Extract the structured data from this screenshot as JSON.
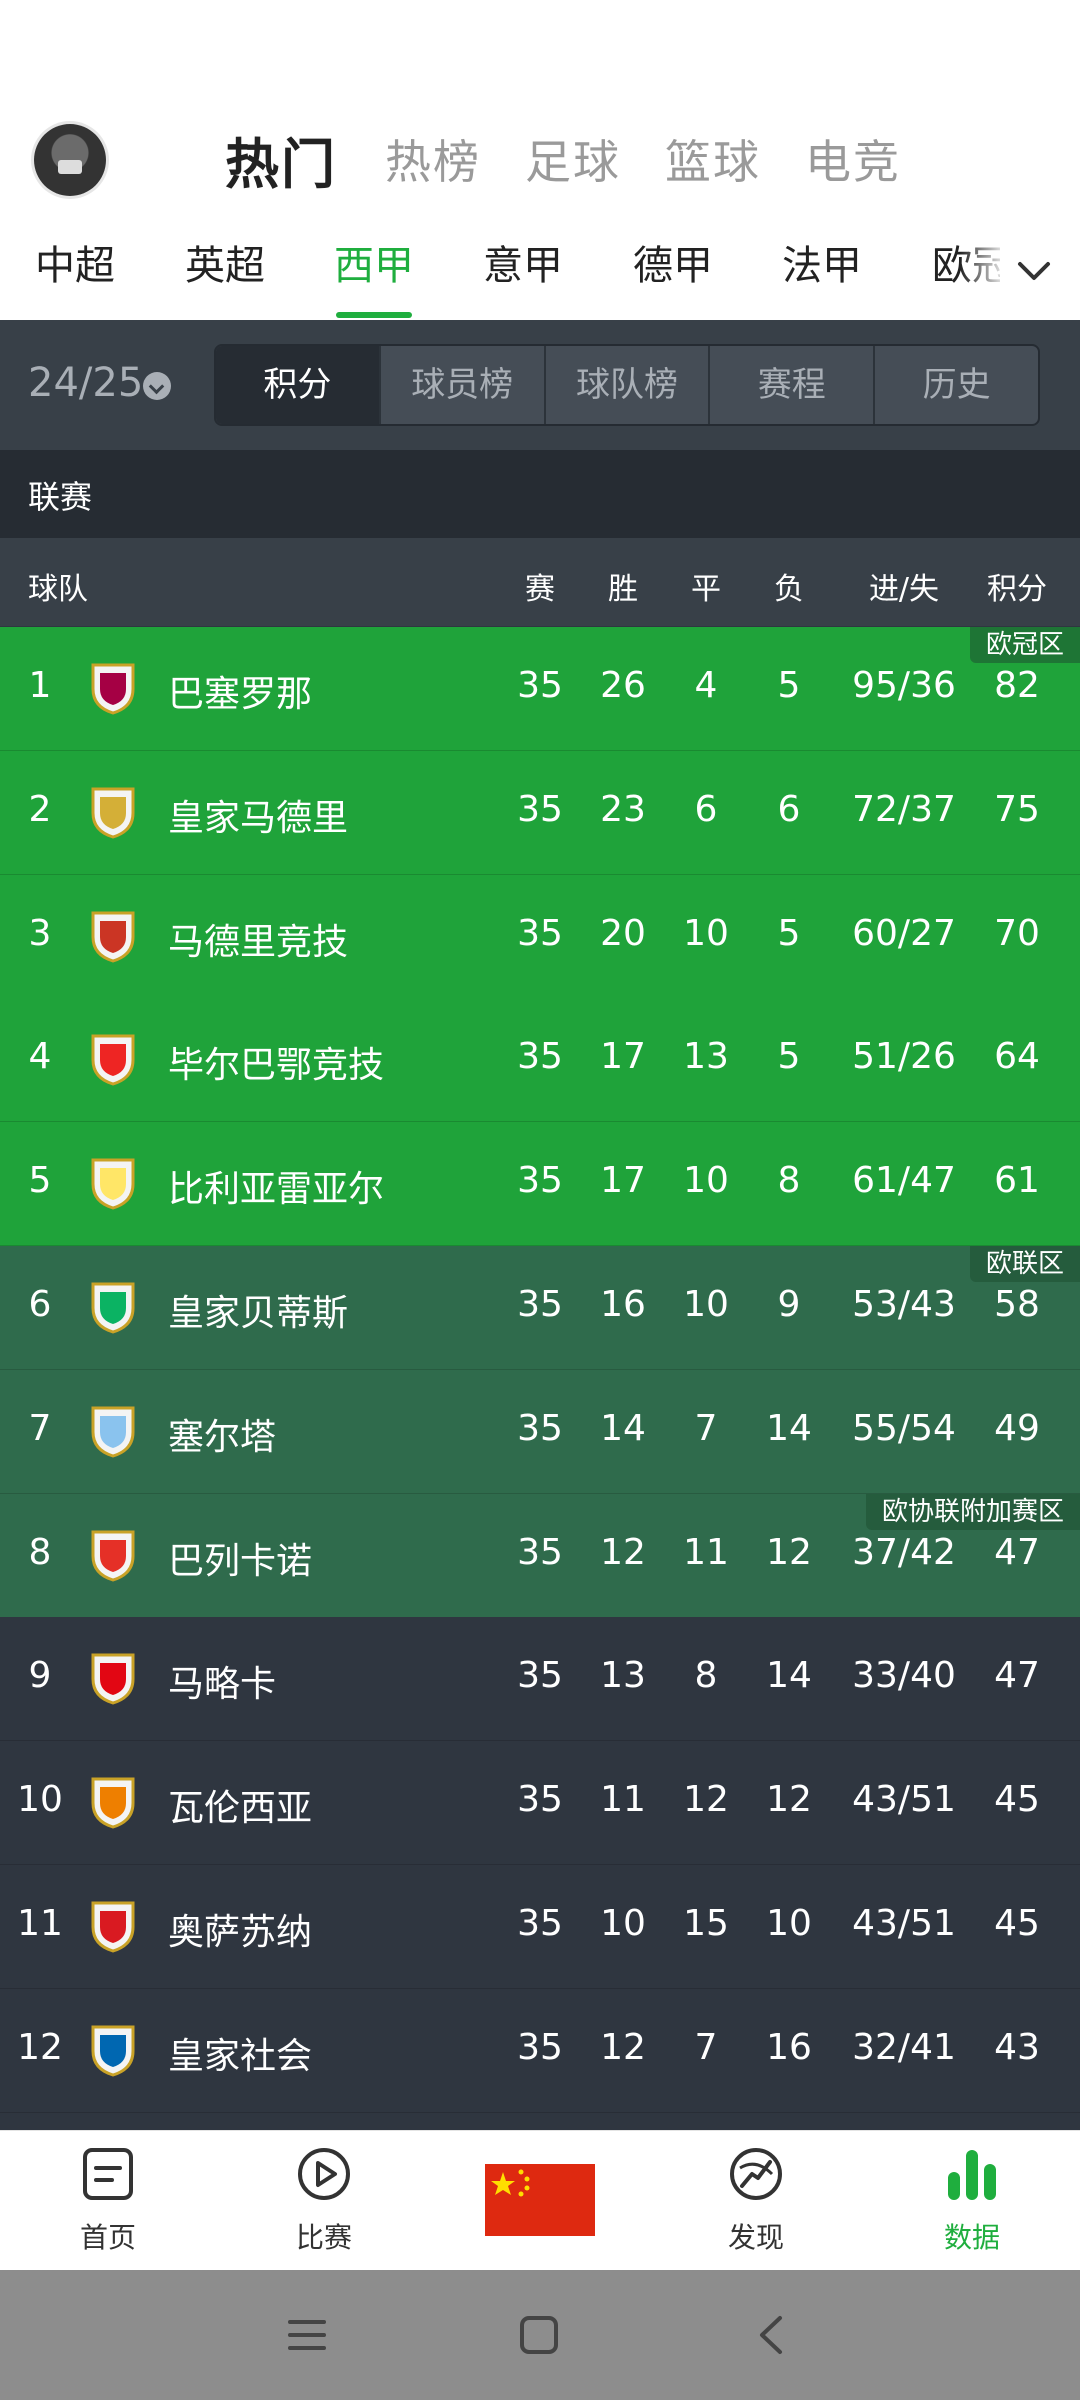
{
  "header": {
    "main_tabs": [
      {
        "label": "热门",
        "active": true
      },
      {
        "label": "热榜"
      },
      {
        "label": "足球"
      },
      {
        "label": "篮球"
      },
      {
        "label": "电竞"
      }
    ],
    "league_tabs": [
      {
        "label": "中超"
      },
      {
        "label": "英超"
      },
      {
        "label": "西甲",
        "active": true
      },
      {
        "label": "意甲"
      },
      {
        "label": "德甲"
      },
      {
        "label": "法甲"
      },
      {
        "label": "欧冠"
      }
    ]
  },
  "season": "24/25",
  "sub_tabs": [
    {
      "label": "积分",
      "active": true
    },
    {
      "label": "球员榜"
    },
    {
      "label": "球队榜"
    },
    {
      "label": "赛程"
    },
    {
      "label": "历史"
    }
  ],
  "section": "联赛",
  "columns": {
    "team": "球队",
    "played": "赛",
    "win": "胜",
    "draw": "平",
    "loss": "负",
    "goals": "进/失",
    "points": "积分"
  },
  "zones": {
    "ucl": "欧冠区",
    "uel": "欧联区",
    "uecl": "欧协联附加赛区"
  },
  "colors": {
    "ucl": "#1fa33a",
    "uel": "#2f6b4c",
    "normal": "#2f3640",
    "accent": "#1fae3e"
  },
  "standings": [
    {
      "rank": "1",
      "team": "巴塞罗那",
      "played": "35",
      "win": "26",
      "draw": "4",
      "loss": "5",
      "goals": "95/36",
      "points": "82",
      "logo": "barcelona-logo"
    },
    {
      "rank": "2",
      "team": "皇家马德里",
      "played": "35",
      "win": "23",
      "draw": "6",
      "loss": "6",
      "goals": "72/37",
      "points": "75",
      "logo": "real-madrid-logo"
    },
    {
      "rank": "3",
      "team": "马德里竞技",
      "played": "35",
      "win": "20",
      "draw": "10",
      "loss": "5",
      "goals": "60/27",
      "points": "70",
      "logo": "atletico-logo"
    },
    {
      "rank": "4",
      "team": "毕尔巴鄂竞技",
      "played": "35",
      "win": "17",
      "draw": "13",
      "loss": "5",
      "goals": "51/26",
      "points": "64",
      "logo": "athletic-logo"
    },
    {
      "rank": "5",
      "team": "比利亚雷亚尔",
      "played": "35",
      "win": "17",
      "draw": "10",
      "loss": "8",
      "goals": "61/47",
      "points": "61",
      "logo": "villarreal-logo"
    },
    {
      "rank": "6",
      "team": "皇家贝蒂斯",
      "played": "35",
      "win": "16",
      "draw": "10",
      "loss": "9",
      "goals": "53/43",
      "points": "58",
      "logo": "betis-logo"
    },
    {
      "rank": "7",
      "team": "塞尔塔",
      "played": "35",
      "win": "14",
      "draw": "7",
      "loss": "14",
      "goals": "55/54",
      "points": "49",
      "logo": "celta-logo"
    },
    {
      "rank": "8",
      "team": "巴列卡诺",
      "played": "35",
      "win": "12",
      "draw": "11",
      "loss": "12",
      "goals": "37/42",
      "points": "47",
      "logo": "rayo-logo"
    },
    {
      "rank": "9",
      "team": "马略卡",
      "played": "35",
      "win": "13",
      "draw": "8",
      "loss": "14",
      "goals": "33/40",
      "points": "47",
      "logo": "mallorca-logo"
    },
    {
      "rank": "10",
      "team": "瓦伦西亚",
      "played": "35",
      "win": "11",
      "draw": "12",
      "loss": "12",
      "goals": "43/51",
      "points": "45",
      "logo": "valencia-logo"
    },
    {
      "rank": "11",
      "team": "奥萨苏纳",
      "played": "35",
      "win": "10",
      "draw": "15",
      "loss": "10",
      "goals": "43/51",
      "points": "45",
      "logo": "osasuna-logo"
    },
    {
      "rank": "12",
      "team": "皇家社会",
      "played": "35",
      "win": "12",
      "draw": "7",
      "loss": "16",
      "goals": "32/41",
      "points": "43",
      "logo": "real-sociedad-logo"
    }
  ],
  "bottom_nav": [
    {
      "label": "首页",
      "icon": "home-doc-icon"
    },
    {
      "label": "比赛",
      "icon": "play-icon"
    },
    {
      "label": "",
      "icon": "china-flag-icon"
    },
    {
      "label": "发现",
      "icon": "discover-icon"
    },
    {
      "label": "数据",
      "icon": "bar-chart-icon",
      "active": true
    }
  ]
}
